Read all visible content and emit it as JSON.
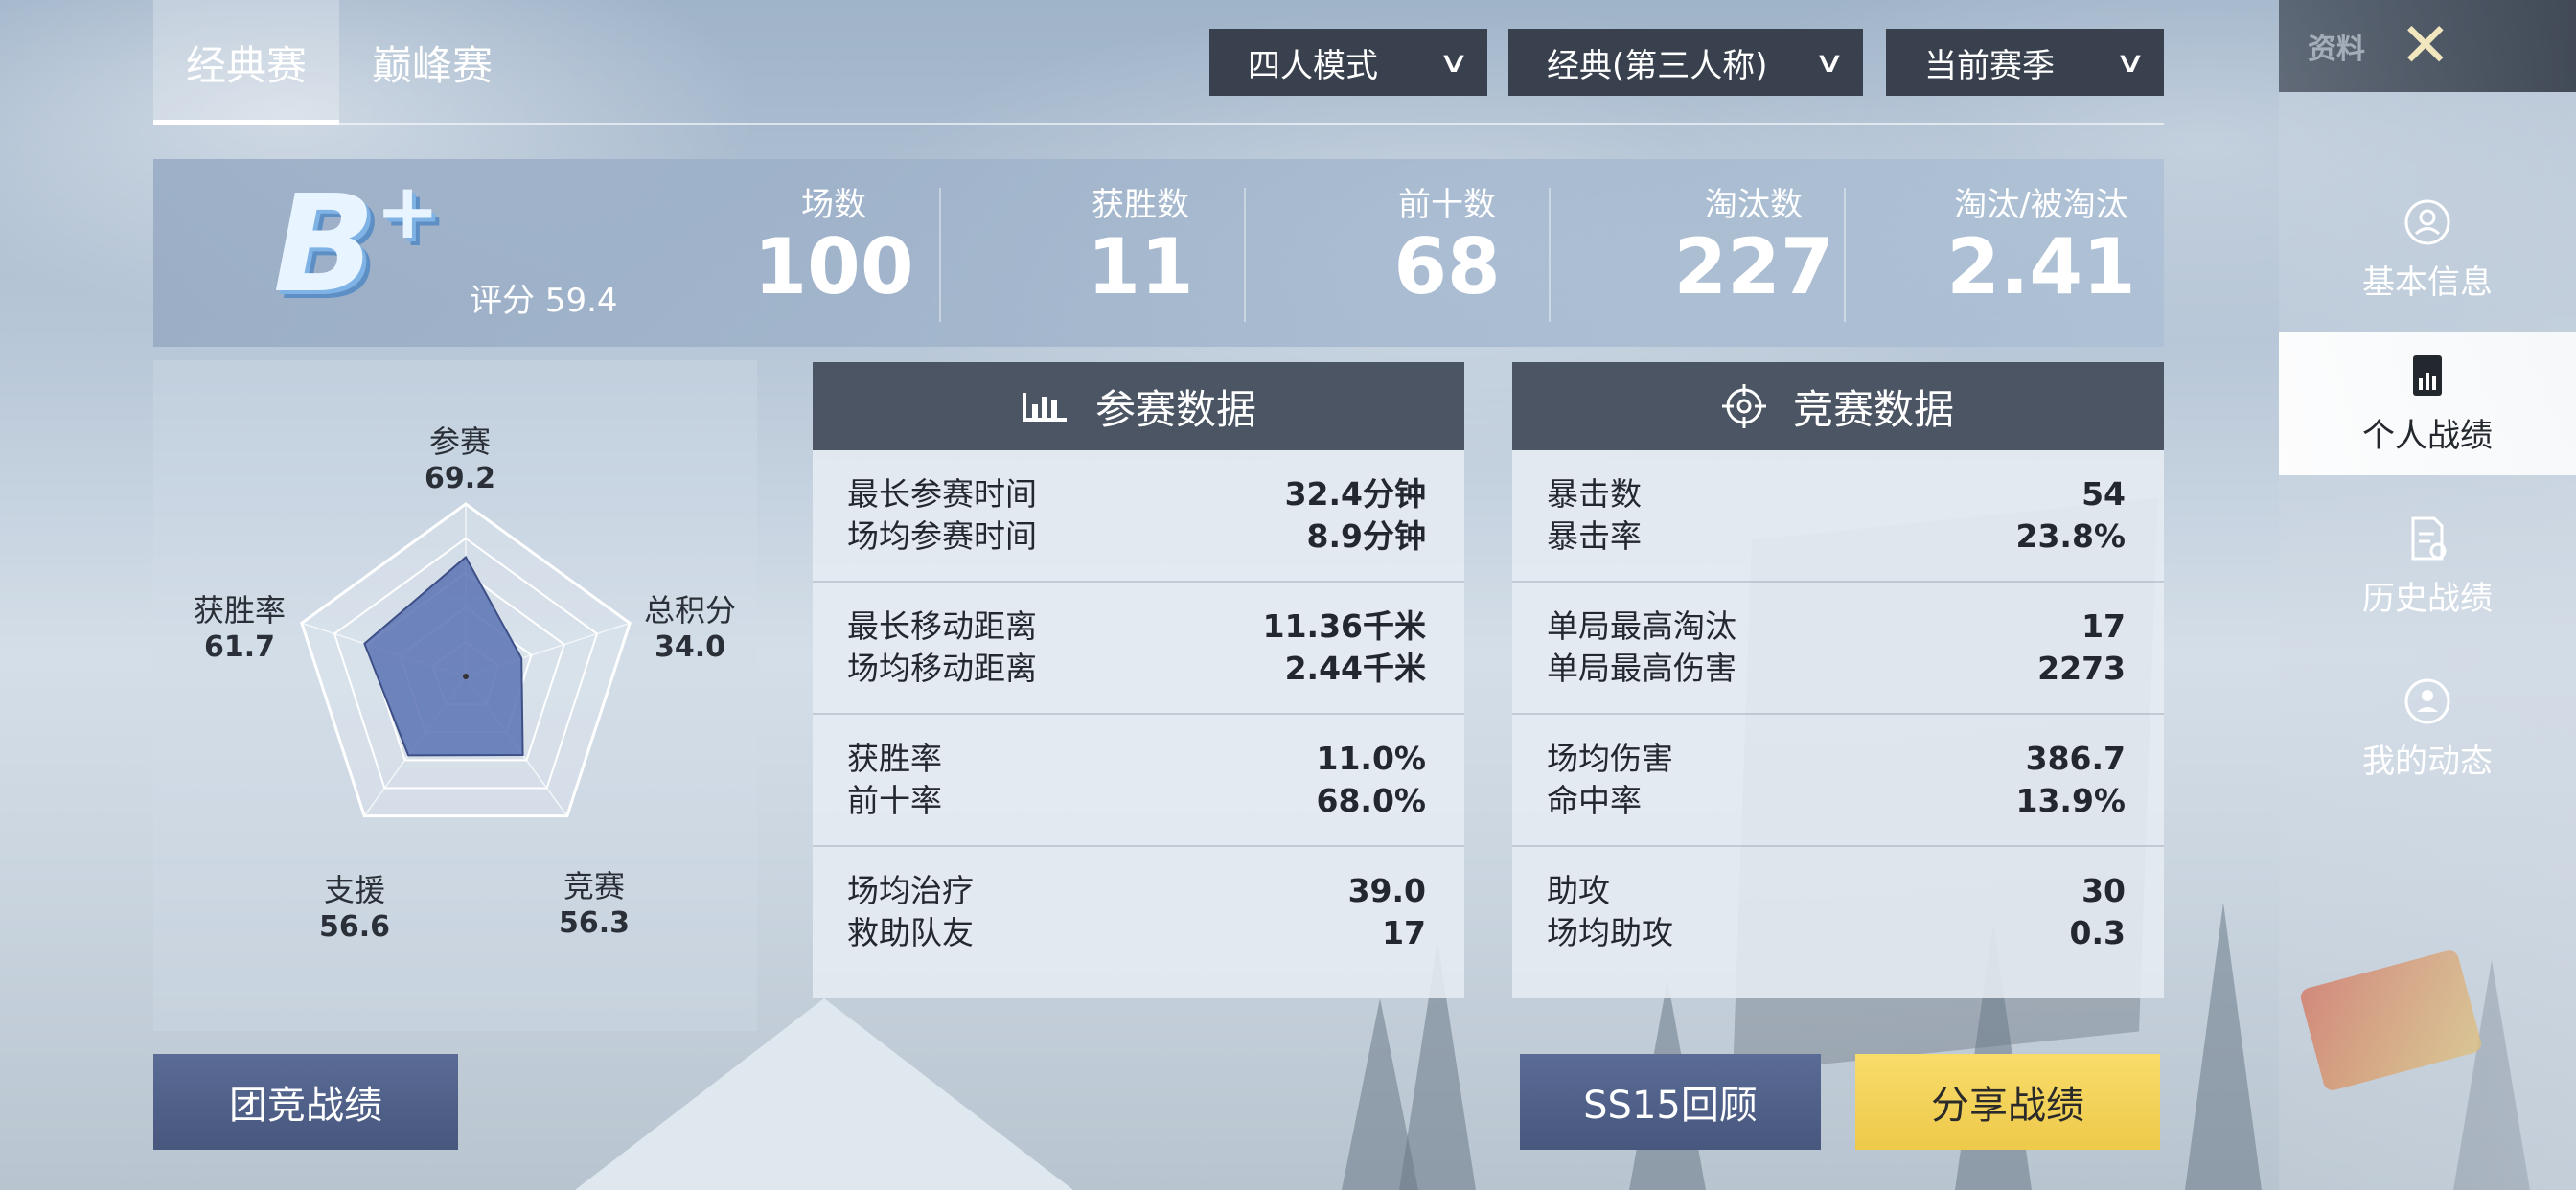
{
  "tabs": [
    {
      "label": "经典赛",
      "active": true
    },
    {
      "label": "巅峰赛",
      "active": false
    }
  ],
  "filters": {
    "mode": "四人模式",
    "perspective": "经典(第三人称)",
    "season": "当前赛季"
  },
  "close": {
    "label": "资料",
    "icon": "close-x-icon"
  },
  "sidebar": {
    "items": [
      {
        "label": "基本信息",
        "icon": "profile-icon",
        "active": false
      },
      {
        "label": "个人战绩",
        "icon": "stats-doc-icon",
        "active": true
      },
      {
        "label": "历史战绩",
        "icon": "history-doc-icon",
        "active": false
      },
      {
        "label": "我的动态",
        "icon": "activity-icon",
        "active": false
      }
    ]
  },
  "summary": {
    "grade": "B",
    "grade_suffix": "+",
    "score": "评分 59.4",
    "stats": [
      {
        "label": "场数",
        "value": "100"
      },
      {
        "label": "获胜数",
        "value": "11"
      },
      {
        "label": "前十数",
        "value": "68"
      },
      {
        "label": "淘汰数",
        "value": "227"
      },
      {
        "label": "淘汰/被淘汰",
        "value": "2.41"
      }
    ]
  },
  "radar": {
    "axes": [
      {
        "label": "参赛",
        "value": "69.2",
        "num": 69.2
      },
      {
        "label": "总积分",
        "value": "34.0",
        "num": 34.0
      },
      {
        "label": "竞赛",
        "value": "56.3",
        "num": 56.3
      },
      {
        "label": "支援",
        "value": "56.6",
        "num": 56.6
      },
      {
        "label": "获胜率",
        "value": "61.7",
        "num": 61.7
      }
    ],
    "fill_color": "#5a72b3"
  },
  "participation": {
    "title": "参赛数据",
    "icon": "bar-chart-icon",
    "groups": [
      [
        {
          "label": "最长参赛时间",
          "value": "32.4分钟"
        },
        {
          "label": "场均参赛时间",
          "value": "8.9分钟"
        }
      ],
      [
        {
          "label": "最长移动距离",
          "value": "11.36千米"
        },
        {
          "label": "场均移动距离",
          "value": "2.44千米"
        }
      ],
      [
        {
          "label": "获胜率",
          "value": "11.0%"
        },
        {
          "label": "前十率",
          "value": "68.0%"
        }
      ],
      [
        {
          "label": "场均治疗",
          "value": "39.0"
        },
        {
          "label": "救助队友",
          "value": "17"
        }
      ]
    ]
  },
  "competition": {
    "title": "竞赛数据",
    "icon": "crosshair-icon",
    "groups": [
      [
        {
          "label": "暴击数",
          "value": "54"
        },
        {
          "label": "暴击率",
          "value": "23.8%"
        }
      ],
      [
        {
          "label": "单局最高淘汰",
          "value": "17"
        },
        {
          "label": "单局最高伤害",
          "value": "2273"
        }
      ],
      [
        {
          "label": "场均伤害",
          "value": "386.7"
        },
        {
          "label": "命中率",
          "value": "13.9%"
        }
      ],
      [
        {
          "label": "助攻",
          "value": "30"
        },
        {
          "label": "场均助攻",
          "value": "0.3"
        }
      ]
    ]
  },
  "buttons": {
    "team": "团竞战绩",
    "review": "SS15回顾",
    "share": "分享战绩"
  }
}
